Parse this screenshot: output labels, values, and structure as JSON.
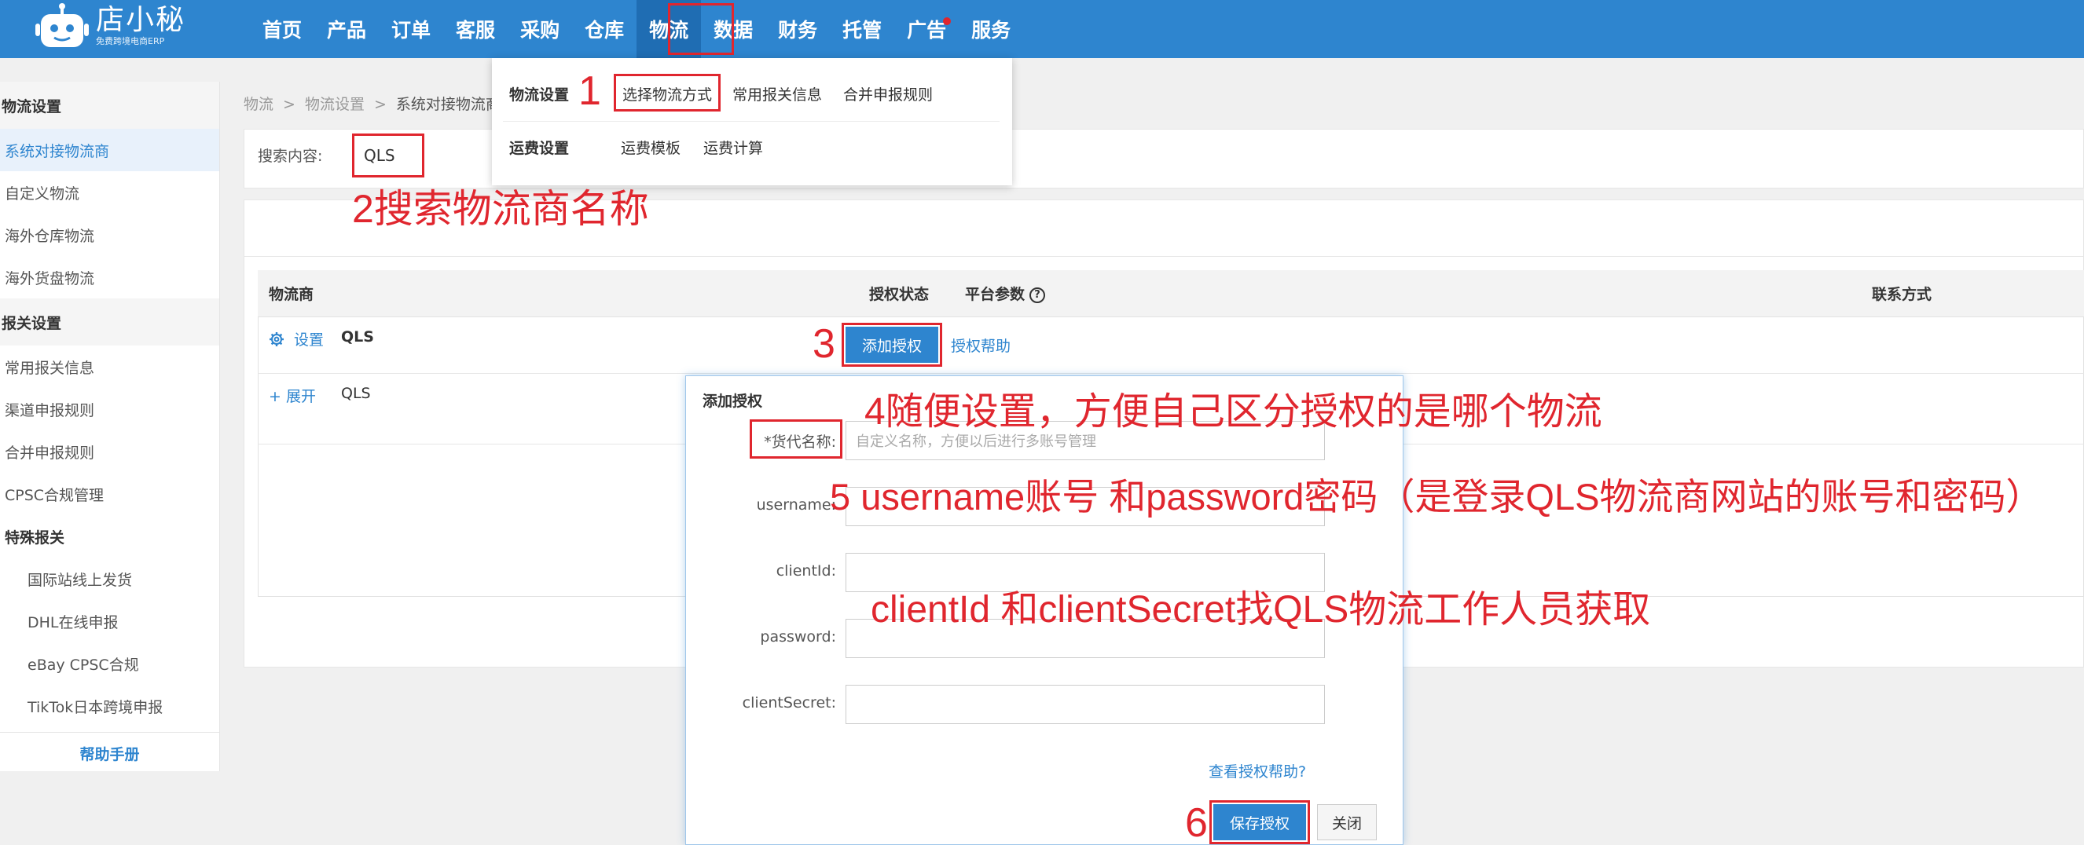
{
  "header": {
    "logo_text": "店小秘",
    "logo_subtext": "免费跨境电商ERP",
    "nav": [
      "首页",
      "产品",
      "订单",
      "客服",
      "采购",
      "仓库",
      "物流",
      "数据",
      "财务",
      "托管",
      "广告",
      "服务"
    ],
    "active_nav": "物流"
  },
  "dropdown": {
    "group1_title": "物流设置",
    "group1_links": [
      "选择物流方式",
      "常用报关信息",
      "合并申报规则"
    ],
    "group2_title": "运费设置",
    "group2_links": [
      "运费模板",
      "运费计算"
    ]
  },
  "sidebar": {
    "group1": "物流设置",
    "items1": [
      "系统对接物流商",
      "自定义物流",
      "海外仓库物流",
      "海外货盘物流"
    ],
    "group2": "报关设置",
    "items2": [
      "常用报关信息",
      "渠道申报规则",
      "合并申报规则",
      "CPSC合规管理"
    ],
    "special_head": "特殊报关",
    "special_items": [
      "国际站线上发货",
      "DHL在线申报",
      "eBay CPSC合规",
      "TikTok日本跨境申报"
    ],
    "help": "帮助手册"
  },
  "breadcrumb": [
    "物流",
    ">",
    "物流设置",
    ">",
    "系统对接物流商"
  ],
  "search": {
    "label": "搜索内容:",
    "value": "QLS"
  },
  "table": {
    "headers": {
      "carrier": "物流商",
      "auth_status": "授权状态",
      "platform_params": "平台参数",
      "contact": "联系方式"
    },
    "row1": {
      "settings": "设置",
      "name": "QLS",
      "add_auth": "添加授权",
      "auth_help": "授权帮助"
    },
    "row2": {
      "expand": "+ 展开",
      "name": "QLS"
    }
  },
  "modal": {
    "title": "添加授权",
    "fields": [
      {
        "label": "*货代名称:",
        "placeholder": "自定义名称，方便以后进行多账号管理"
      },
      {
        "label": "username:",
        "placeholder": ""
      },
      {
        "label": "clientId:",
        "placeholder": ""
      },
      {
        "label": "password:",
        "placeholder": ""
      },
      {
        "label": "clientSecret:",
        "placeholder": ""
      }
    ],
    "view_help": "查看授权帮助?",
    "save": "保存授权",
    "close": "关闭"
  },
  "annotations": {
    "a1": "1",
    "a2": "2搜索物流商名称",
    "a3": "3",
    "a4": "4随便设置，方便自己区分授权的是哪个物流",
    "a5": "5 username账号 和password密码（是登录QLS物流商网站的账号和密码）",
    "a_client": "clientId 和clientSecret找QLS物流工作人员获取",
    "a6": "6",
    "color": "#e0262e"
  },
  "colors": {
    "brand": "#2e85cf",
    "annotation": "#e0262e"
  }
}
